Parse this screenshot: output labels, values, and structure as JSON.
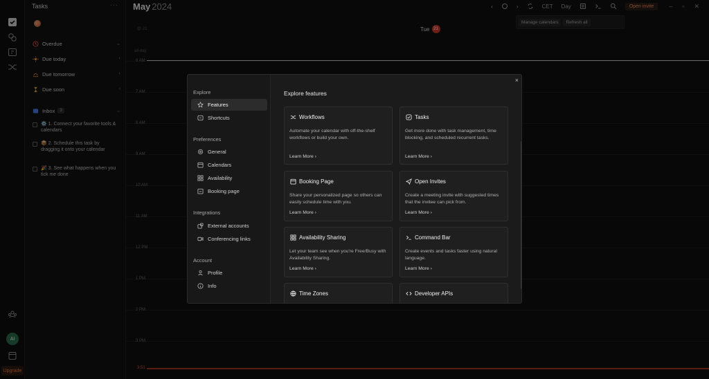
{
  "sidebar": {
    "avatar_initials": "AI",
    "upgrade_label": "Upgrade"
  },
  "tasks": {
    "title": "Tasks",
    "more_label": "···",
    "groups": [
      {
        "label": "Overdue",
        "color": "#e0523c",
        "icon": "clock-icon"
      },
      {
        "label": "Due today",
        "color": "#e0863c",
        "icon": "sun-icon"
      },
      {
        "label": "Due tomorrow",
        "color": "#e0863c",
        "icon": "sunrise-icon"
      },
      {
        "label": "Due soon",
        "color": "#e0a03c",
        "icon": "hourglass-icon"
      }
    ],
    "inbox": {
      "label": "Inbox",
      "count": "3"
    },
    "items": [
      "⚙️ 1. Connect your favorite tools & calendars",
      "📦 2. Schedule this task by dragging it onto your calendar",
      "🎉 3. See what happens when you tick me done"
    ]
  },
  "calendar": {
    "month": "May",
    "year": "2024",
    "timezone_label": "CET",
    "view_label": "Day",
    "open_invite_label": "Open invite",
    "manage_calendars_label": "Manage calendars",
    "refresh_label": "Refresh all",
    "tz_offset": "@ 21",
    "day_name": "Tue",
    "day_number": "21",
    "allday_label": "all-day",
    "hours": [
      "6 AM",
      "7 AM",
      "8 AM",
      "9 AM",
      "10 AM",
      "11 AM",
      "12 PM",
      "1 PM",
      "2 PM",
      "3 PM"
    ],
    "now_label": "3:51"
  },
  "modal": {
    "close_label": "×",
    "sections": [
      {
        "title": "Explore",
        "items": [
          {
            "label": "Features",
            "active": true
          },
          {
            "label": "Shortcuts"
          }
        ]
      },
      {
        "title": "Preferences",
        "items": [
          {
            "label": "General"
          },
          {
            "label": "Calendars"
          },
          {
            "label": "Availability"
          },
          {
            "label": "Booking page"
          }
        ]
      },
      {
        "title": "Integrations",
        "items": [
          {
            "label": "External accounts"
          },
          {
            "label": "Conferencing links"
          }
        ]
      },
      {
        "title": "Account",
        "items": [
          {
            "label": "Profile"
          },
          {
            "label": "Info"
          }
        ]
      }
    ],
    "title": "Explore features",
    "learn_more_label": "Learn More",
    "cards": [
      {
        "title": "Workflows",
        "icon": "shuffle-icon",
        "desc": "Automate your calendar with off-the-shelf workflows or build your own."
      },
      {
        "title": "Tasks",
        "icon": "check-square-icon",
        "desc": "Get more done with task management, time blocking, and scheduled recurrent tasks."
      },
      {
        "title": "Booking Page",
        "icon": "calendar-icon",
        "desc": "Share your personalized page so others can easily schedule time with you."
      },
      {
        "title": "Open Invites",
        "icon": "send-icon",
        "desc": "Create a meeting invite with suggested times that the invitee can pick from."
      },
      {
        "title": "Availability Sharing",
        "icon": "grid-icon",
        "desc": "Let your team see when you're Free/Busy with Availability Sharing."
      },
      {
        "title": "Command Bar",
        "icon": "terminal-icon",
        "desc": "Create events and tasks faster using natural language."
      },
      {
        "title": "Time Zones",
        "icon": "globe-icon",
        "desc": ""
      },
      {
        "title": "Developer APIs",
        "icon": "code-icon",
        "desc": ""
      }
    ]
  }
}
